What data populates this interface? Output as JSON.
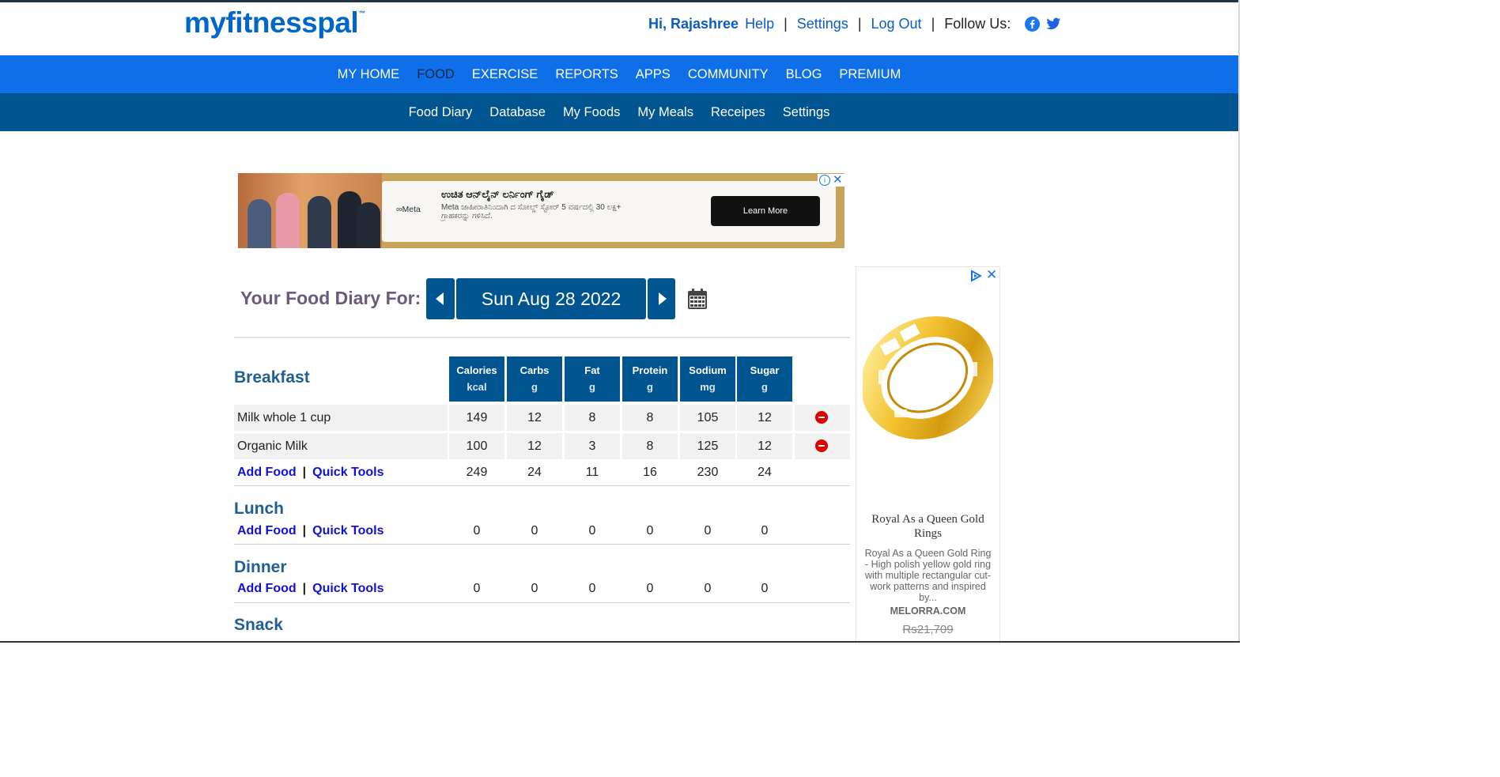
{
  "header": {
    "logo": "myfitnesspal",
    "logo_tm": "™",
    "greeting": "Hi, Rajashree",
    "help": "Help",
    "settings": "Settings",
    "logout": "Log Out",
    "follow": "Follow Us:",
    "sep": "|"
  },
  "nav_main": [
    "MY HOME",
    "FOOD",
    "EXERCISE",
    "REPORTS",
    "APPS",
    "COMMUNITY",
    "BLOG",
    "PREMIUM"
  ],
  "nav_main_active": "FOOD",
  "nav_sub": [
    "Food Diary",
    "Database",
    "My Foods",
    "My Meals",
    "Receipes",
    "Settings"
  ],
  "ad_top": {
    "brand": "∞Meta",
    "title": "ಉಚಿತ ಆನ್‌ಲೈನ್ ಲರ್ನಿಂಗ್ ಗೈಡ್",
    "body": "Meta ಜಾಹೀರಾತಿನಿಂದಾಗಿ ದ ಸೋಲ್ಡ್ ಸ್ಟೋರ್ 5 ವರ್ಷದಲ್ಲಿ 30 ಲಕ್ಷ+ ಗ್ರಾಹಕರನ್ನು ಗಳಿಸಿದೆ.",
    "cta": "Learn More"
  },
  "diary": {
    "label": "Your Food Diary For:",
    "date": "Sun Aug 28 2022"
  },
  "columns": [
    {
      "name": "Calories",
      "unit": "kcal"
    },
    {
      "name": "Carbs",
      "unit": "g"
    },
    {
      "name": "Fat",
      "unit": "g"
    },
    {
      "name": "Protein",
      "unit": "g"
    },
    {
      "name": "Sodium",
      "unit": "mg"
    },
    {
      "name": "Sugar",
      "unit": "g"
    }
  ],
  "meals": {
    "breakfast": {
      "name": "Breakfast",
      "items": [
        {
          "name": "Milk whole 1 cup",
          "values": [
            "149",
            "12",
            "8",
            "8",
            "105",
            "12"
          ]
        },
        {
          "name": "Organic Milk",
          "values": [
            "100",
            "12",
            "3",
            "8",
            "125",
            "12"
          ]
        }
      ],
      "totals": [
        "249",
        "24",
        "11",
        "16",
        "230",
        "24"
      ]
    },
    "lunch": {
      "name": "Lunch",
      "totals": [
        "0",
        "0",
        "0",
        "0",
        "0",
        "0"
      ]
    },
    "dinner": {
      "name": "Dinner",
      "totals": [
        "0",
        "0",
        "0",
        "0",
        "0",
        "0"
      ]
    },
    "snack": {
      "name": "Snack"
    }
  },
  "links": {
    "add_food": "Add Food",
    "pipe": "|",
    "quick_tools": "Quick Tools"
  },
  "ad_right": {
    "title": "Royal As a Queen Gold Rings",
    "body": "Royal As a Queen Gold Ring - High polish yellow gold ring with multiple rectangular cut-work patterns and inspired by...",
    "site": "MELORRA.COM",
    "price": "Rs21,709"
  },
  "colors": {
    "nav_main": "#0f6fe8",
    "nav_sub": "#00548f",
    "link": "#1010d8",
    "meal_title": "#1f5f94",
    "delete": "#e00000"
  }
}
